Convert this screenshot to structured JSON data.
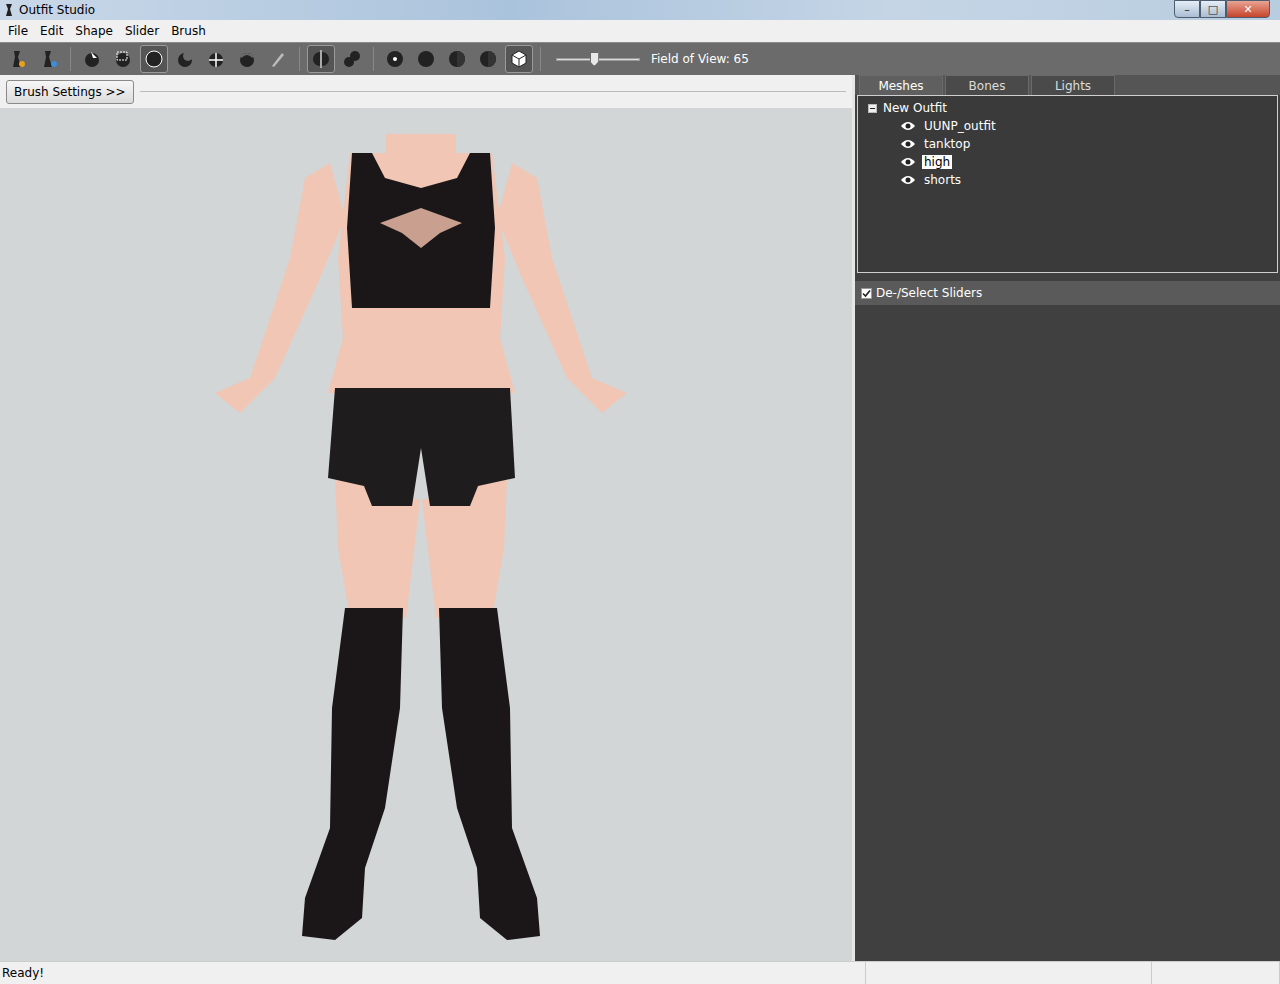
{
  "window": {
    "title": "Outfit Studio",
    "controls": [
      {
        "label": "–",
        "kind": "minimize"
      },
      {
        "label": "□",
        "kind": "maximize"
      },
      {
        "label": "✕",
        "kind": "close"
      }
    ]
  },
  "menu": [
    "File",
    "Edit",
    "Shape",
    "Slider",
    "Brush"
  ],
  "toolbar": {
    "tools": [
      {
        "kind": "outfit",
        "selected": false
      },
      {
        "kind": "reference",
        "selected": false
      },
      {
        "kind": "select",
        "selected": false
      },
      {
        "kind": "mask",
        "selected": false
      },
      {
        "kind": "inflate",
        "selected": true
      },
      {
        "kind": "deflate",
        "selected": false
      },
      {
        "kind": "move",
        "selected": false
      },
      {
        "kind": "smooth",
        "selected": false
      },
      {
        "kind": "paint",
        "selected": false
      },
      {
        "kind": "mirror",
        "selected": true
      },
      {
        "kind": "connected",
        "selected": false
      },
      {
        "kind": "dot",
        "selected": false
      },
      {
        "kind": "circle",
        "selected": false
      },
      {
        "kind": "half",
        "selected": false
      },
      {
        "kind": "half",
        "selected": false
      },
      {
        "kind": "cube",
        "selected": true
      }
    ],
    "fov": {
      "label": "Field of View: 65",
      "level": 0.45
    }
  },
  "brush_settings": {
    "label": "Brush Settings >>"
  },
  "tabs": [
    {
      "label": "Meshes",
      "selected": true
    },
    {
      "label": "Bones",
      "selected": false
    },
    {
      "label": "Lights",
      "selected": false
    }
  ],
  "tree": {
    "root": "New Outfit",
    "expanded": true,
    "items": [
      {
        "label": "UUNP_outfit",
        "visible": true,
        "selected": false
      },
      {
        "label": "tanktop",
        "visible": true,
        "selected": false
      },
      {
        "label": "high",
        "visible": true,
        "selected": true
      },
      {
        "label": "shorts",
        "visible": true,
        "selected": false
      }
    ]
  },
  "sliders": {
    "label": "De-/Select Sliders",
    "checked": true
  },
  "status_bar": {
    "text": "Ready!"
  }
}
